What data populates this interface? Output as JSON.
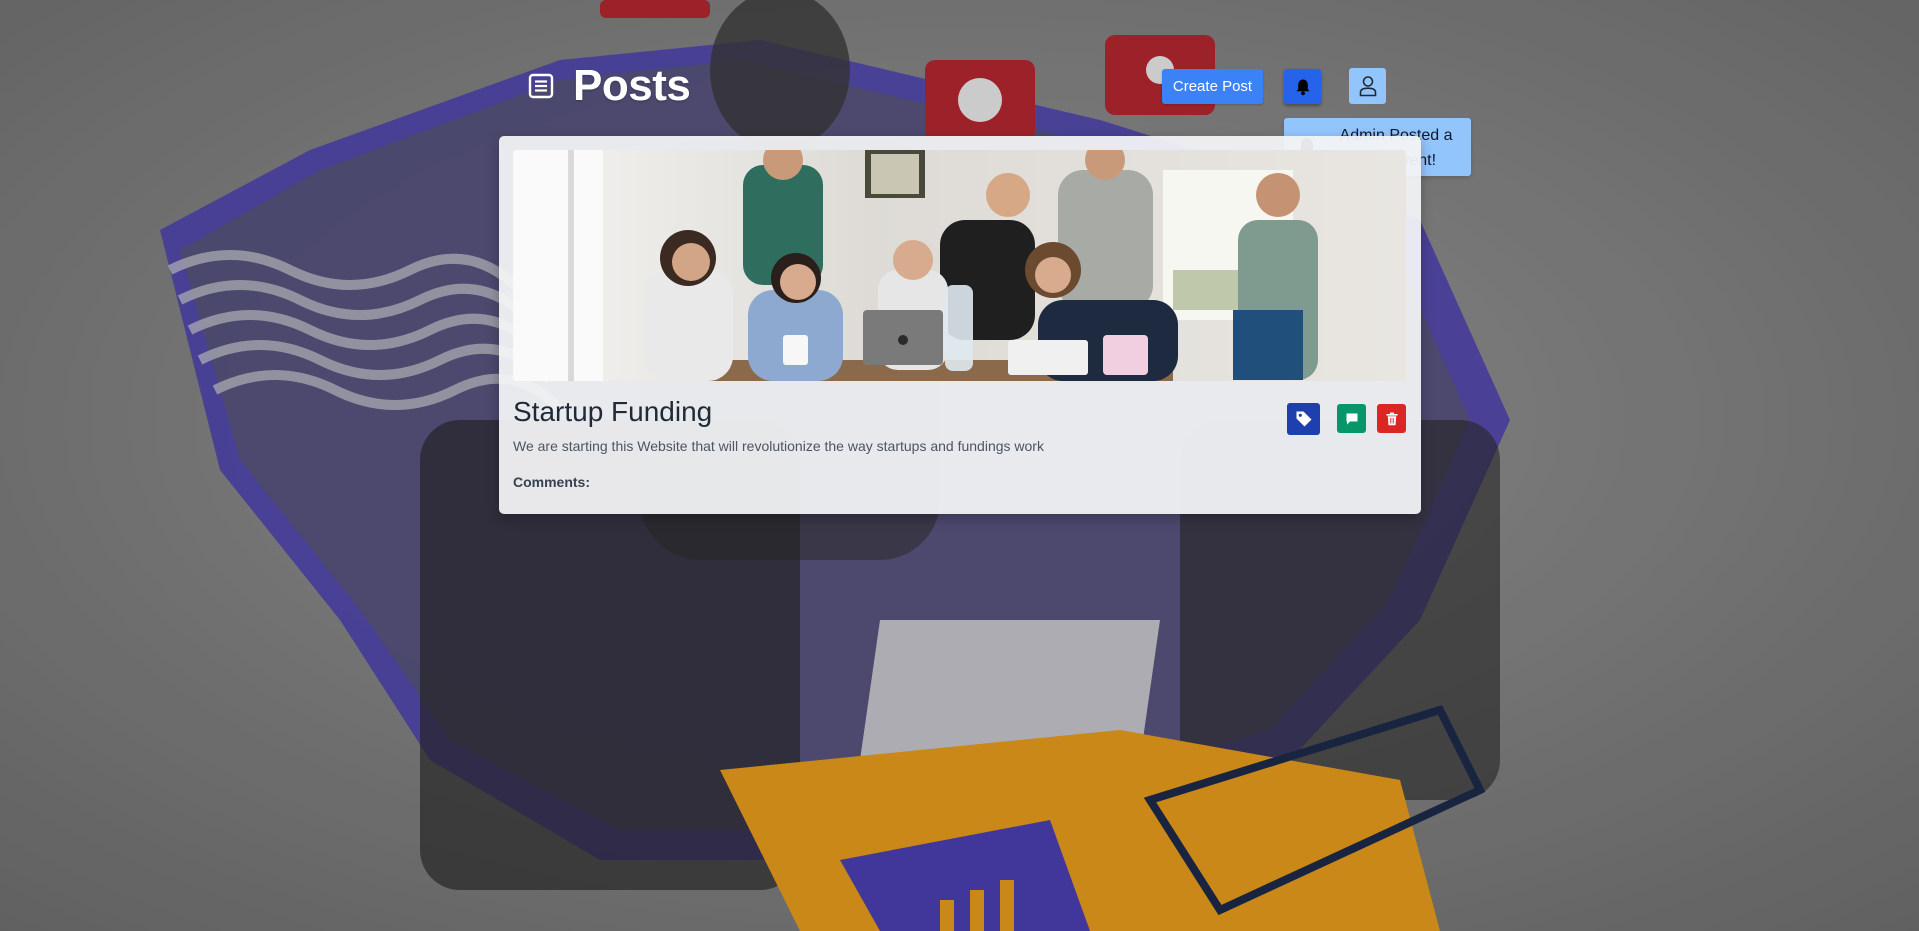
{
  "header": {
    "title": "Posts",
    "icon": "document-list-icon"
  },
  "toolbar": {
    "create_post_label": "Create Post",
    "notifications_icon": "bell-icon",
    "profile_icon": "user-icon"
  },
  "notification": {
    "icon": "bell-icon",
    "message": "Admin Posted a New event!"
  },
  "post": {
    "image_description_icon": "post-image",
    "title": "Startup Funding",
    "description": "We are starting this Website that will revolutionize the way startups and fundings work",
    "comments_label": "Comments:",
    "actions": {
      "tag_icon": "tag-icon",
      "comment_icon": "comment-icon",
      "delete_icon": "trash-icon"
    }
  },
  "colors": {
    "primary_button": "#3b82f6",
    "bell_button": "#2563eb",
    "profile_button": "#93c5fd",
    "notification_bg": "#93c5fd",
    "tag_button": "#1e40af",
    "comment_button": "#059669",
    "delete_button": "#dc2626",
    "card_bg": "#f3f4f6"
  }
}
